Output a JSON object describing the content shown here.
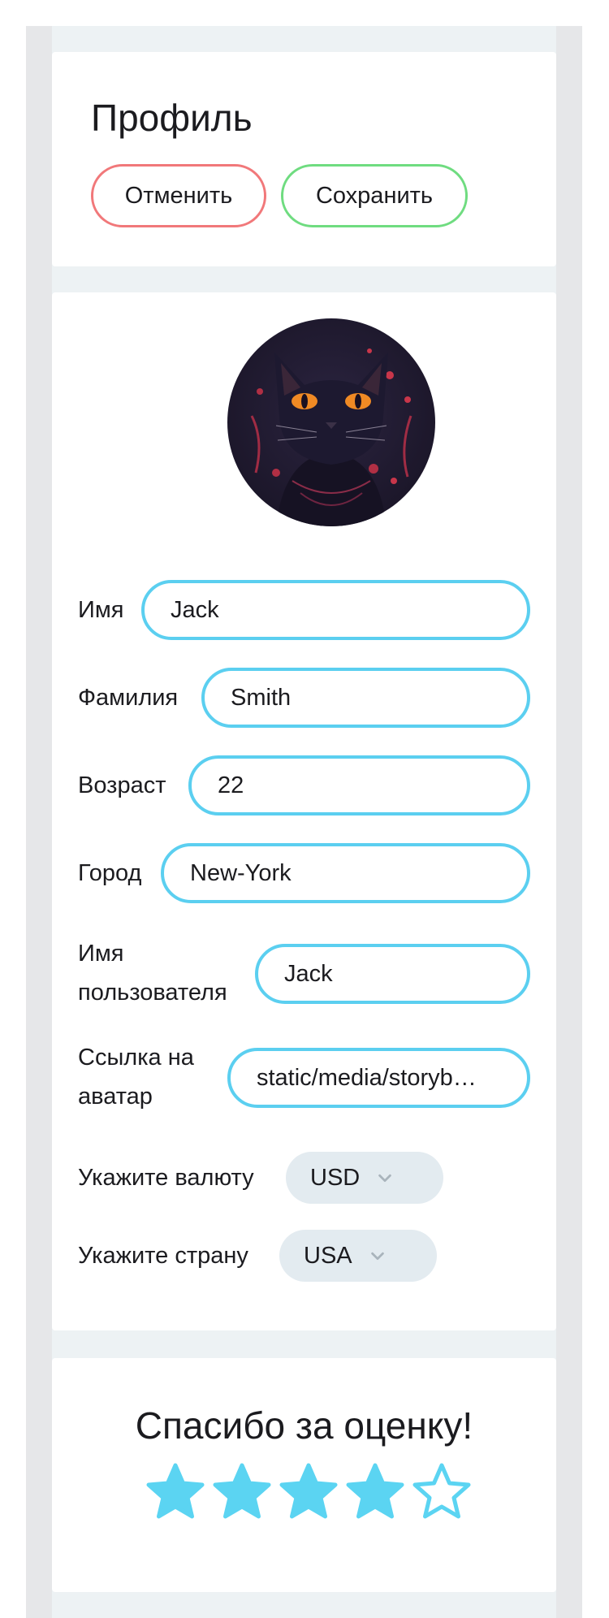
{
  "header": {
    "title": "Профиль",
    "cancel_label": "Отменить",
    "save_label": "Сохранить"
  },
  "profile": {
    "fields": {
      "first_name": {
        "label": "Имя",
        "value": "Jack"
      },
      "last_name": {
        "label": "Фамилия",
        "value": "Smith"
      },
      "age": {
        "label": "Возраст",
        "value": "22"
      },
      "city": {
        "label": "Город",
        "value": "New-York"
      },
      "username": {
        "label": "Имя пользователя",
        "value": "Jack"
      },
      "avatar_link": {
        "label": "Ссылка на аватар",
        "value": "static/media/storyb…"
      }
    },
    "currency": {
      "label": "Укажите валюту",
      "value": "USD"
    },
    "country": {
      "label": "Укажите страну",
      "value": "USA"
    }
  },
  "rating": {
    "title": "Спасибо за оценку!",
    "value": 4,
    "max": 5
  },
  "colors": {
    "cancel_border": "#f1787a",
    "save_border": "#6fdc80",
    "input_border": "#5bcff0",
    "star": "#5bd4f2"
  },
  "icons": {
    "select_arrow": "chevron-down-icon",
    "rating_star": "star-icon"
  }
}
